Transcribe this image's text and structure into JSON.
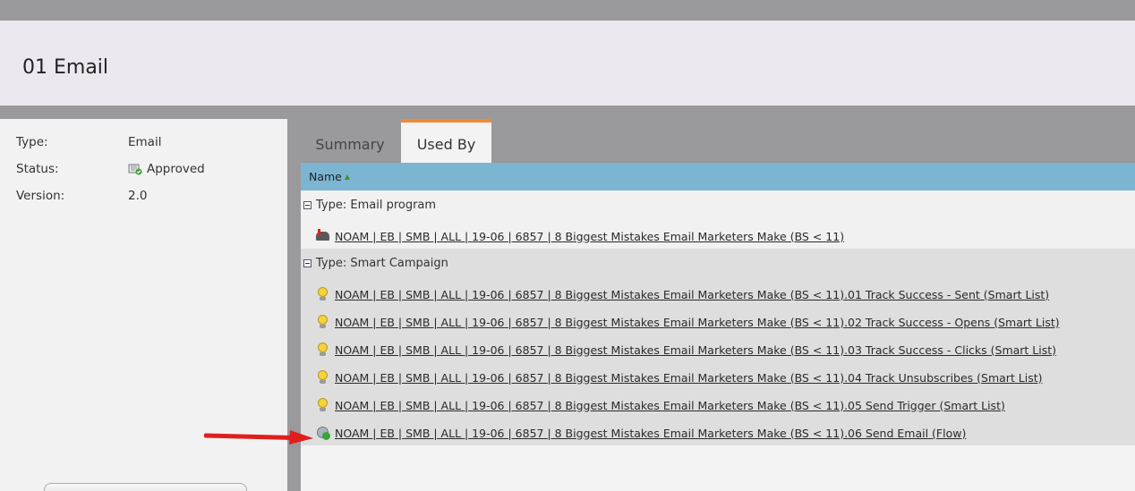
{
  "header": {
    "title": "01 Email"
  },
  "properties": [
    {
      "label": "Type:",
      "value": "Email"
    },
    {
      "label": "Status:",
      "value": "Approved",
      "icon": "approved-icon"
    },
    {
      "label": "Version:",
      "value": "2.0"
    }
  ],
  "tabs": [
    {
      "label": "Summary",
      "active": false
    },
    {
      "label": "Used By",
      "active": true
    }
  ],
  "table": {
    "column": "Name",
    "groups": [
      {
        "label": "Type: Email program",
        "items": [
          {
            "icon": "email-program-icon",
            "label": "NOAM | EB | SMB | ALL | 19-06 | 6857 | 8 Biggest Mistakes Email Marketers Make (BS < 11)"
          }
        ]
      },
      {
        "label": "Type: Smart Campaign",
        "items": [
          {
            "icon": "smart-list-bulb-icon",
            "label": "NOAM | EB | SMB | ALL | 19-06 | 6857 | 8 Biggest Mistakes Email Marketers Make (BS < 11).01 Track Success - Sent (Smart List)"
          },
          {
            "icon": "smart-list-bulb-icon",
            "label": "NOAM | EB | SMB | ALL | 19-06 | 6857 | 8 Biggest Mistakes Email Marketers Make (BS < 11).02 Track Success - Opens (Smart List)"
          },
          {
            "icon": "smart-list-bulb-icon",
            "label": "NOAM | EB | SMB | ALL | 19-06 | 6857 | 8 Biggest Mistakes Email Marketers Make (BS < 11).03 Track Success - Clicks (Smart List)"
          },
          {
            "icon": "smart-list-bulb-icon",
            "label": "NOAM | EB | SMB | ALL | 19-06 | 6857 | 8 Biggest Mistakes Email Marketers Make (BS < 11).04 Track Unsubscribes (Smart List)"
          },
          {
            "icon": "smart-list-bulb-icon",
            "label": "NOAM | EB | SMB | ALL | 19-06 | 6857 | 8 Biggest Mistakes Email Marketers Make (BS < 11).05 Send Trigger (Smart List)"
          },
          {
            "icon": "flow-icon",
            "label": "NOAM | EB | SMB | ALL | 19-06 | 6857 | 8 Biggest Mistakes Email Marketers Make (BS < 11).06 Send Email (Flow)"
          }
        ]
      }
    ]
  },
  "colors": {
    "accent_tab": "#ef8a36",
    "column_header": "#7cb5d2",
    "arrow": "#e01e1e"
  }
}
